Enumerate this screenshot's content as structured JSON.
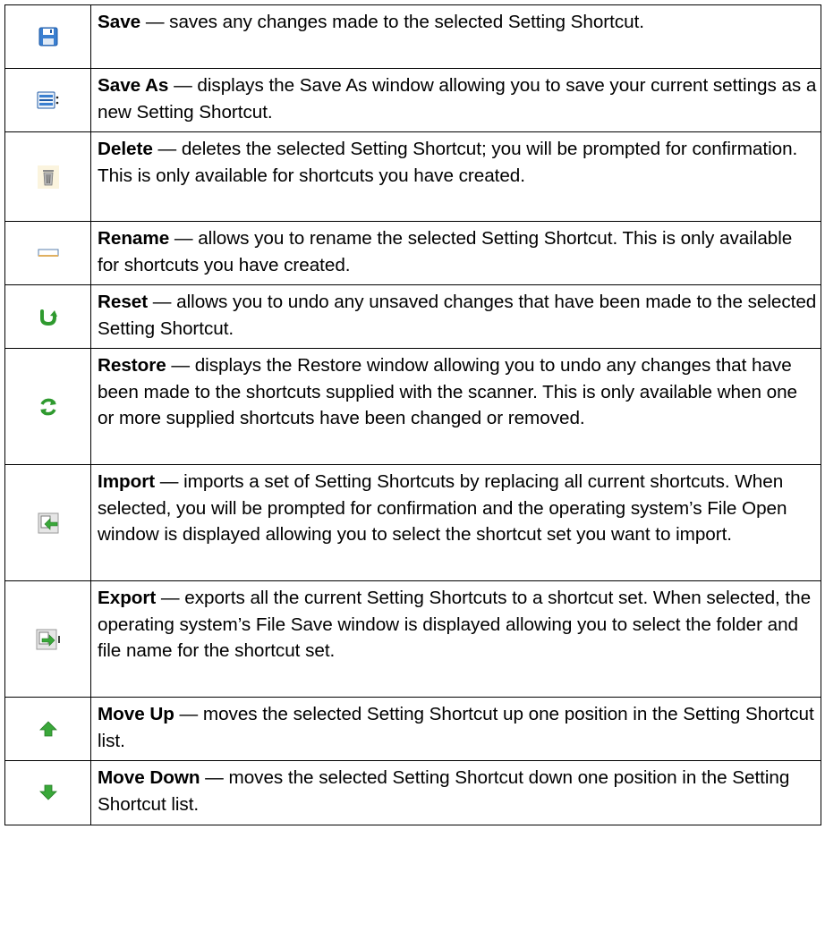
{
  "commands": [
    {
      "icon": "save-icon",
      "name": "Save",
      "description": " — saves any changes made to the selected Setting Shortcut."
    },
    {
      "icon": "save-as-icon",
      "name": "Save As",
      "description": " — displays the Save As window allowing you to save your current settings as a new Setting Shortcut."
    },
    {
      "icon": "delete-icon",
      "name": "Delete",
      "description": " — deletes the selected Setting Shortcut; you will be prompted for confirmation. This is only available for shortcuts you have created."
    },
    {
      "icon": "rename-icon",
      "name": "Rename",
      "description": " — allows you to rename the selected Setting Shortcut. This is only available for shortcuts you have created."
    },
    {
      "icon": "reset-icon",
      "name": "Reset",
      "description": " — allows you to undo any unsaved changes that have been made to the selected Setting Shortcut."
    },
    {
      "icon": "restore-icon",
      "name": "Restore",
      "description": " — displays the Restore window allowing you to undo any changes that have been made to the shortcuts supplied with the scanner. This is only available when one or more supplied shortcuts have been changed or removed."
    },
    {
      "icon": "import-icon",
      "name": "Import",
      "description": " — imports a set of Setting Shortcuts by replacing all current shortcuts. When selected, you will be prompted for confirmation and the operating system’s File Open window is displayed allowing you to select the shortcut set you want to import."
    },
    {
      "icon": "export-icon",
      "name": "Export",
      "description": " — exports all the current Setting Shortcuts to a shortcut set. When selected, the operating system’s File Save window is displayed allowing you to select the folder and file name for the shortcut set."
    },
    {
      "icon": "move-up-icon",
      "name": "Move Up",
      "description": " — moves the selected Setting Shortcut up one position in the Setting Shortcut list."
    },
    {
      "icon": "move-down-icon",
      "name": "Move Down",
      "description": " — moves the selected Setting Shortcut down one position in the Setting Shortcut list."
    }
  ]
}
